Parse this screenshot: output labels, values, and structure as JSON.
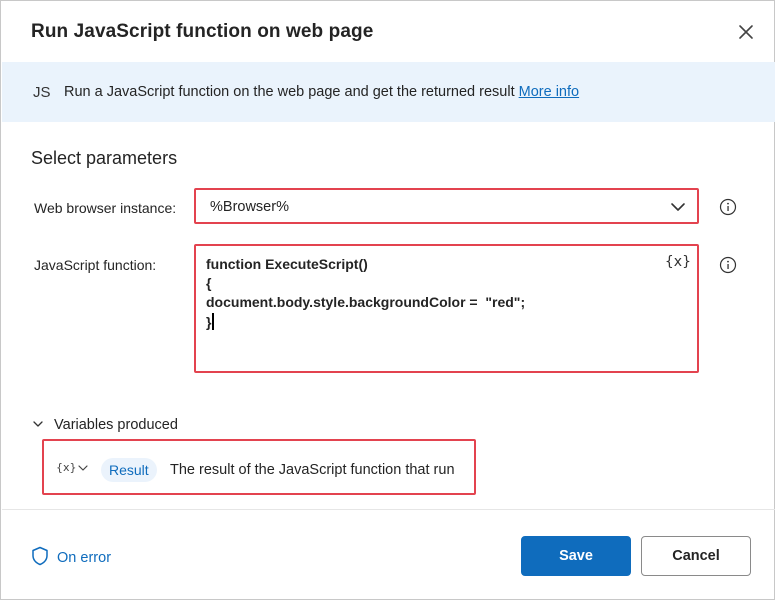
{
  "dialog": {
    "title": "Run JavaScript function on web page",
    "close_icon": "close-icon"
  },
  "info": {
    "badge": "JS",
    "text": "Run a JavaScript function on the web page and get the returned result",
    "link": "More info"
  },
  "section_title": "Select parameters",
  "params": {
    "browser": {
      "label": "Web browser instance:",
      "value": "%Browser%",
      "icon": "chevron-down-icon"
    },
    "js_function": {
      "label": "JavaScript function:",
      "lines": [
        "function ExecuteScript()",
        "{",
        "document.body.style.backgroundColor =  \"red\";",
        "}"
      ],
      "var_button": "{x}"
    }
  },
  "variables": {
    "header": "Variables produced",
    "items": [
      {
        "type_icon": "{x}",
        "name": "Result",
        "description": "The result of the JavaScript function that run"
      }
    ]
  },
  "footer": {
    "on_error": "On error",
    "save": "Save",
    "cancel": "Cancel"
  },
  "colors": {
    "accent": "#0f6cbd",
    "highlight_border": "#e3434f",
    "info_bar": "#eaf3fc"
  }
}
